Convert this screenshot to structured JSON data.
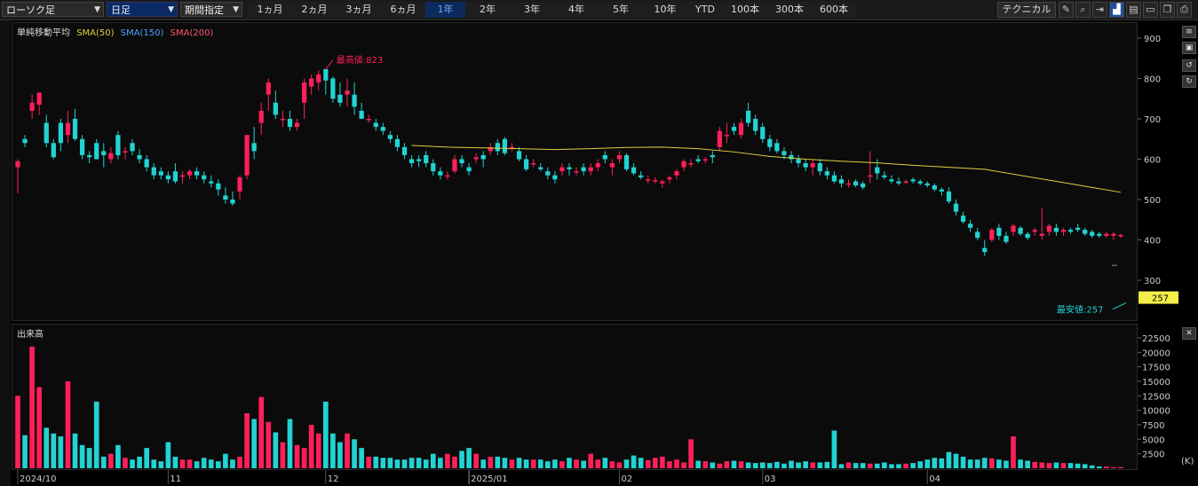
{
  "toolbar": {
    "chart_type": "ローソク足",
    "interval": "日足",
    "period_select": "期間指定",
    "periods": [
      "1ヵ月",
      "2ヵ月",
      "3ヵ月",
      "6ヵ月",
      "1年",
      "2年",
      "3年",
      "4年",
      "5年",
      "10年",
      "YTD",
      "100本",
      "300本",
      "600本"
    ],
    "active_period": "1年",
    "technical": "テクニカル",
    "icons": [
      "pencil-icon",
      "zoom-icon",
      "exit-icon",
      "chart-icon",
      "save-icon",
      "folder-icon",
      "copy-icon",
      "print-icon",
      "settings-icon"
    ]
  },
  "legend": {
    "title": "単純移動平均",
    "sma50": "SMA(50)",
    "sma150": "SMA(150)",
    "sma200": "SMA(200)"
  },
  "colors": {
    "up": "#ff1f5a",
    "down": "#22d3d3",
    "sma50": "#e0d040",
    "sma150": "#4fa3ff",
    "sma200": "#ff5577",
    "highlight": "#f5ee4a"
  },
  "volume_label": "出来高",
  "volume_unit": "(K)",
  "high_label": "最高値:823",
  "low_label": "最安値:257",
  "price_tag": "257",
  "chart_data": [
    {
      "type": "candlestick",
      "title": "",
      "ylim": [
        200,
        920
      ],
      "yticks": [
        300,
        400,
        500,
        600,
        700,
        800,
        900
      ],
      "xticks": [
        "2024/10",
        "11",
        "12",
        "2025/01",
        "02",
        "03",
        "04"
      ],
      "xtick_index": [
        0,
        21,
        43,
        63,
        84,
        104,
        127
      ],
      "ohlc": [
        [
          580,
          600,
          515,
          595
        ],
        [
          650,
          660,
          630,
          640
        ],
        [
          720,
          760,
          700,
          740
        ],
        [
          735,
          765,
          710,
          765
        ],
        [
          690,
          710,
          630,
          640
        ],
        [
          640,
          650,
          600,
          605
        ],
        [
          690,
          700,
          620,
          640
        ],
        [
          660,
          720,
          640,
          690
        ],
        [
          700,
          725,
          645,
          650
        ],
        [
          650,
          660,
          600,
          610
        ],
        [
          610,
          620,
          590,
          605
        ],
        [
          640,
          650,
          600,
          600
        ],
        [
          620,
          640,
          580,
          610
        ],
        [
          600,
          630,
          590,
          615
        ],
        [
          660,
          670,
          600,
          610
        ],
        [
          620,
          630,
          600,
          620
        ],
        [
          640,
          650,
          610,
          620
        ],
        [
          610,
          625,
          590,
          600
        ],
        [
          600,
          610,
          570,
          580
        ],
        [
          580,
          590,
          550,
          560
        ],
        [
          570,
          580,
          550,
          560
        ],
        [
          560,
          570,
          540,
          550
        ],
        [
          570,
          590,
          540,
          545
        ],
        [
          560,
          570,
          540,
          560
        ],
        [
          560,
          575,
          550,
          570
        ],
        [
          570,
          580,
          550,
          560
        ],
        [
          560,
          570,
          540,
          550
        ],
        [
          545,
          560,
          530,
          540
        ],
        [
          540,
          550,
          510,
          525
        ],
        [
          510,
          530,
          490,
          500
        ],
        [
          500,
          520,
          485,
          490
        ],
        [
          520,
          560,
          500,
          555
        ],
        [
          560,
          660,
          550,
          660
        ],
        [
          640,
          680,
          600,
          620
        ],
        [
          690,
          740,
          660,
          720
        ],
        [
          760,
          800,
          720,
          790
        ],
        [
          740,
          770,
          700,
          710
        ],
        [
          700,
          720,
          680,
          700
        ],
        [
          700,
          720,
          670,
          680
        ],
        [
          680,
          700,
          670,
          690
        ],
        [
          740,
          800,
          700,
          790
        ],
        [
          780,
          810,
          760,
          800
        ],
        [
          790,
          820,
          770,
          810
        ],
        [
          823,
          823,
          760,
          795
        ],
        [
          800,
          805,
          740,
          750
        ],
        [
          760,
          790,
          730,
          740
        ],
        [
          760,
          800,
          730,
          770
        ],
        [
          760,
          790,
          710,
          730
        ],
        [
          720,
          740,
          700,
          700
        ],
        [
          700,
          710,
          690,
          700
        ],
        [
          690,
          700,
          670,
          680
        ],
        [
          680,
          690,
          660,
          670
        ],
        [
          660,
          670,
          640,
          650
        ],
        [
          650,
          660,
          620,
          630
        ],
        [
          630,
          640,
          600,
          610
        ],
        [
          600,
          610,
          580,
          590
        ],
        [
          600,
          610,
          580,
          595
        ],
        [
          610,
          620,
          580,
          590
        ],
        [
          590,
          600,
          560,
          570
        ],
        [
          570,
          580,
          550,
          560
        ],
        [
          560,
          570,
          550,
          560
        ],
        [
          570,
          610,
          565,
          600
        ],
        [
          600,
          610,
          580,
          590
        ],
        [
          580,
          590,
          560,
          570
        ],
        [
          600,
          615,
          590,
          605
        ],
        [
          610,
          620,
          580,
          600
        ],
        [
          620,
          640,
          610,
          630
        ],
        [
          640,
          650,
          610,
          620
        ],
        [
          650,
          655,
          610,
          615
        ],
        [
          630,
          640,
          620,
          630
        ],
        [
          620,
          630,
          595,
          600
        ],
        [
          600,
          610,
          570,
          575
        ],
        [
          590,
          600,
          580,
          590
        ],
        [
          580,
          590,
          570,
          575
        ],
        [
          570,
          580,
          550,
          560
        ],
        [
          560,
          570,
          540,
          550
        ],
        [
          570,
          590,
          560,
          580
        ],
        [
          580,
          590,
          560,
          575
        ],
        [
          570,
          580,
          560,
          570
        ],
        [
          580,
          590,
          560,
          570
        ],
        [
          570,
          590,
          560,
          580
        ],
        [
          580,
          600,
          570,
          590
        ],
        [
          610,
          620,
          590,
          600
        ],
        [
          580,
          600,
          560,
          590
        ],
        [
          600,
          620,
          590,
          610
        ],
        [
          610,
          615,
          570,
          575
        ],
        [
          580,
          590,
          560,
          565
        ],
        [
          560,
          570,
          550,
          555
        ],
        [
          550,
          560,
          540,
          550
        ],
        [
          545,
          555,
          540,
          548
        ],
        [
          540,
          550,
          530,
          545
        ],
        [
          550,
          560,
          540,
          555
        ],
        [
          560,
          575,
          550,
          570
        ],
        [
          580,
          600,
          570,
          595
        ],
        [
          590,
          600,
          580,
          590
        ],
        [
          600,
          610,
          590,
          595
        ],
        [
          600,
          605,
          590,
          600
        ],
        [
          610,
          620,
          590,
          605
        ],
        [
          630,
          680,
          620,
          670
        ],
        [
          660,
          690,
          640,
          660
        ],
        [
          680,
          690,
          660,
          670
        ],
        [
          660,
          700,
          650,
          690
        ],
        [
          720,
          740,
          680,
          690
        ],
        [
          700,
          710,
          660,
          670
        ],
        [
          680,
          690,
          640,
          650
        ],
        [
          650,
          660,
          620,
          630
        ],
        [
          640,
          650,
          615,
          620
        ],
        [
          620,
          630,
          600,
          610
        ],
        [
          610,
          620,
          590,
          600
        ],
        [
          600,
          610,
          580,
          590
        ],
        [
          590,
          600,
          570,
          580
        ],
        [
          580,
          600,
          560,
          590
        ],
        [
          590,
          600,
          560,
          570
        ],
        [
          570,
          580,
          550,
          560
        ],
        [
          560,
          570,
          540,
          545
        ],
        [
          550,
          560,
          530,
          540
        ],
        [
          540,
          550,
          530,
          540
        ],
        [
          545,
          550,
          530,
          535
        ],
        [
          540,
          545,
          525,
          530
        ],
        [
          560,
          620,
          540,
          560
        ],
        [
          580,
          600,
          550,
          565
        ],
        [
          560,
          570,
          550,
          555
        ],
        [
          550,
          560,
          540,
          545
        ],
        [
          545,
          555,
          535,
          540
        ],
        [
          545,
          550,
          540,
          545
        ],
        [
          550,
          555,
          540,
          545
        ],
        [
          545,
          550,
          535,
          540
        ],
        [
          540,
          545,
          530,
          535
        ],
        [
          535,
          540,
          520,
          525
        ],
        [
          525,
          530,
          510,
          520
        ],
        [
          520,
          530,
          490,
          495
        ],
        [
          490,
          500,
          460,
          470
        ],
        [
          460,
          470,
          440,
          445
        ],
        [
          440,
          450,
          420,
          430
        ],
        [
          420,
          430,
          400,
          405
        ],
        [
          380,
          400,
          360,
          370
        ],
        [
          400,
          430,
          395,
          425
        ],
        [
          430,
          440,
          400,
          410
        ],
        [
          410,
          420,
          390,
          395
        ],
        [
          420,
          440,
          410,
          435
        ],
        [
          430,
          435,
          410,
          415
        ],
        [
          415,
          420,
          400,
          405
        ],
        [
          420,
          430,
          410,
          425
        ],
        [
          410,
          480,
          400,
          415
        ],
        [
          420,
          440,
          410,
          435
        ],
        [
          430,
          440,
          410,
          420
        ],
        [
          420,
          430,
          410,
          425
        ],
        [
          425,
          430,
          415,
          420
        ],
        [
          430,
          440,
          420,
          425
        ],
        [
          425,
          430,
          410,
          415
        ],
        [
          420,
          425,
          405,
          410
        ],
        [
          415,
          420,
          405,
          410
        ],
        [
          410,
          420,
          405,
          415
        ],
        [
          410,
          420,
          400,
          415
        ],
        [
          410,
          415,
          405,
          412
        ]
      ],
      "sma50": [
        [
          55,
          634
        ],
        [
          60,
          630
        ],
        [
          65,
          628
        ],
        [
          70,
          626
        ],
        [
          75,
          624
        ],
        [
          80,
          626
        ],
        [
          85,
          629
        ],
        [
          90,
          630
        ],
        [
          95,
          626
        ],
        [
          100,
          618
        ],
        [
          105,
          607
        ],
        [
          110,
          600
        ],
        [
          115,
          595
        ],
        [
          120,
          591
        ],
        [
          125,
          585
        ],
        [
          130,
          580
        ],
        [
          135,
          575
        ],
        [
          140,
          560
        ],
        [
          145,
          545
        ],
        [
          150,
          530
        ],
        [
          154,
          518
        ]
      ]
    },
    {
      "type": "bar",
      "title": "",
      "ylabel": "",
      "ylim": [
        0,
        24000
      ],
      "yticks": [
        2500,
        5000,
        7500,
        10000,
        12500,
        15000,
        17500,
        20000,
        22500
      ],
      "volumes": [
        12500,
        5700,
        21000,
        14000,
        7000,
        6000,
        5500,
        15000,
        6000,
        4000,
        3500,
        11500,
        2000,
        2500,
        4000,
        1800,
        1500,
        2000,
        3500,
        1500,
        1200,
        4500,
        2000,
        1500,
        1500,
        1200,
        1800,
        1500,
        1200,
        2500,
        1500,
        2000,
        9500,
        8500,
        12300,
        8000,
        6200,
        4500,
        8500,
        4000,
        3500,
        7500,
        6000,
        11500,
        6000,
        4500,
        6000,
        5000,
        3500,
        2000,
        2000,
        1800,
        1800,
        1500,
        1500,
        1800,
        1800,
        1500,
        2500,
        1800,
        2500,
        2000,
        3000,
        3500,
        2500,
        1500,
        2000,
        2000,
        1800,
        1500,
        1800,
        1500,
        1500,
        1500,
        1200,
        1500,
        1200,
        1800,
        1500,
        1300,
        2500,
        1500,
        1800,
        1200,
        1000,
        1500,
        2200,
        1800,
        1400,
        1800,
        2000,
        1200,
        1500,
        1000,
        5000,
        1300,
        1200,
        1000,
        800,
        1200,
        1300,
        1200,
        1000,
        900,
        1000,
        900,
        1100,
        800,
        1300,
        1000,
        1200,
        1000,
        1000,
        1100,
        6500,
        700,
        1000,
        900,
        900,
        800,
        800,
        1000,
        700,
        700,
        800,
        900,
        1200,
        1500,
        1800,
        1700,
        2800,
        2500,
        2000,
        1500,
        1500,
        1800,
        1700,
        1500,
        1300,
        5500,
        1500,
        1300,
        1100,
        1000,
        900,
        1000,
        900,
        900,
        800,
        700,
        500,
        300,
        300,
        200,
        200
      ]
    }
  ]
}
